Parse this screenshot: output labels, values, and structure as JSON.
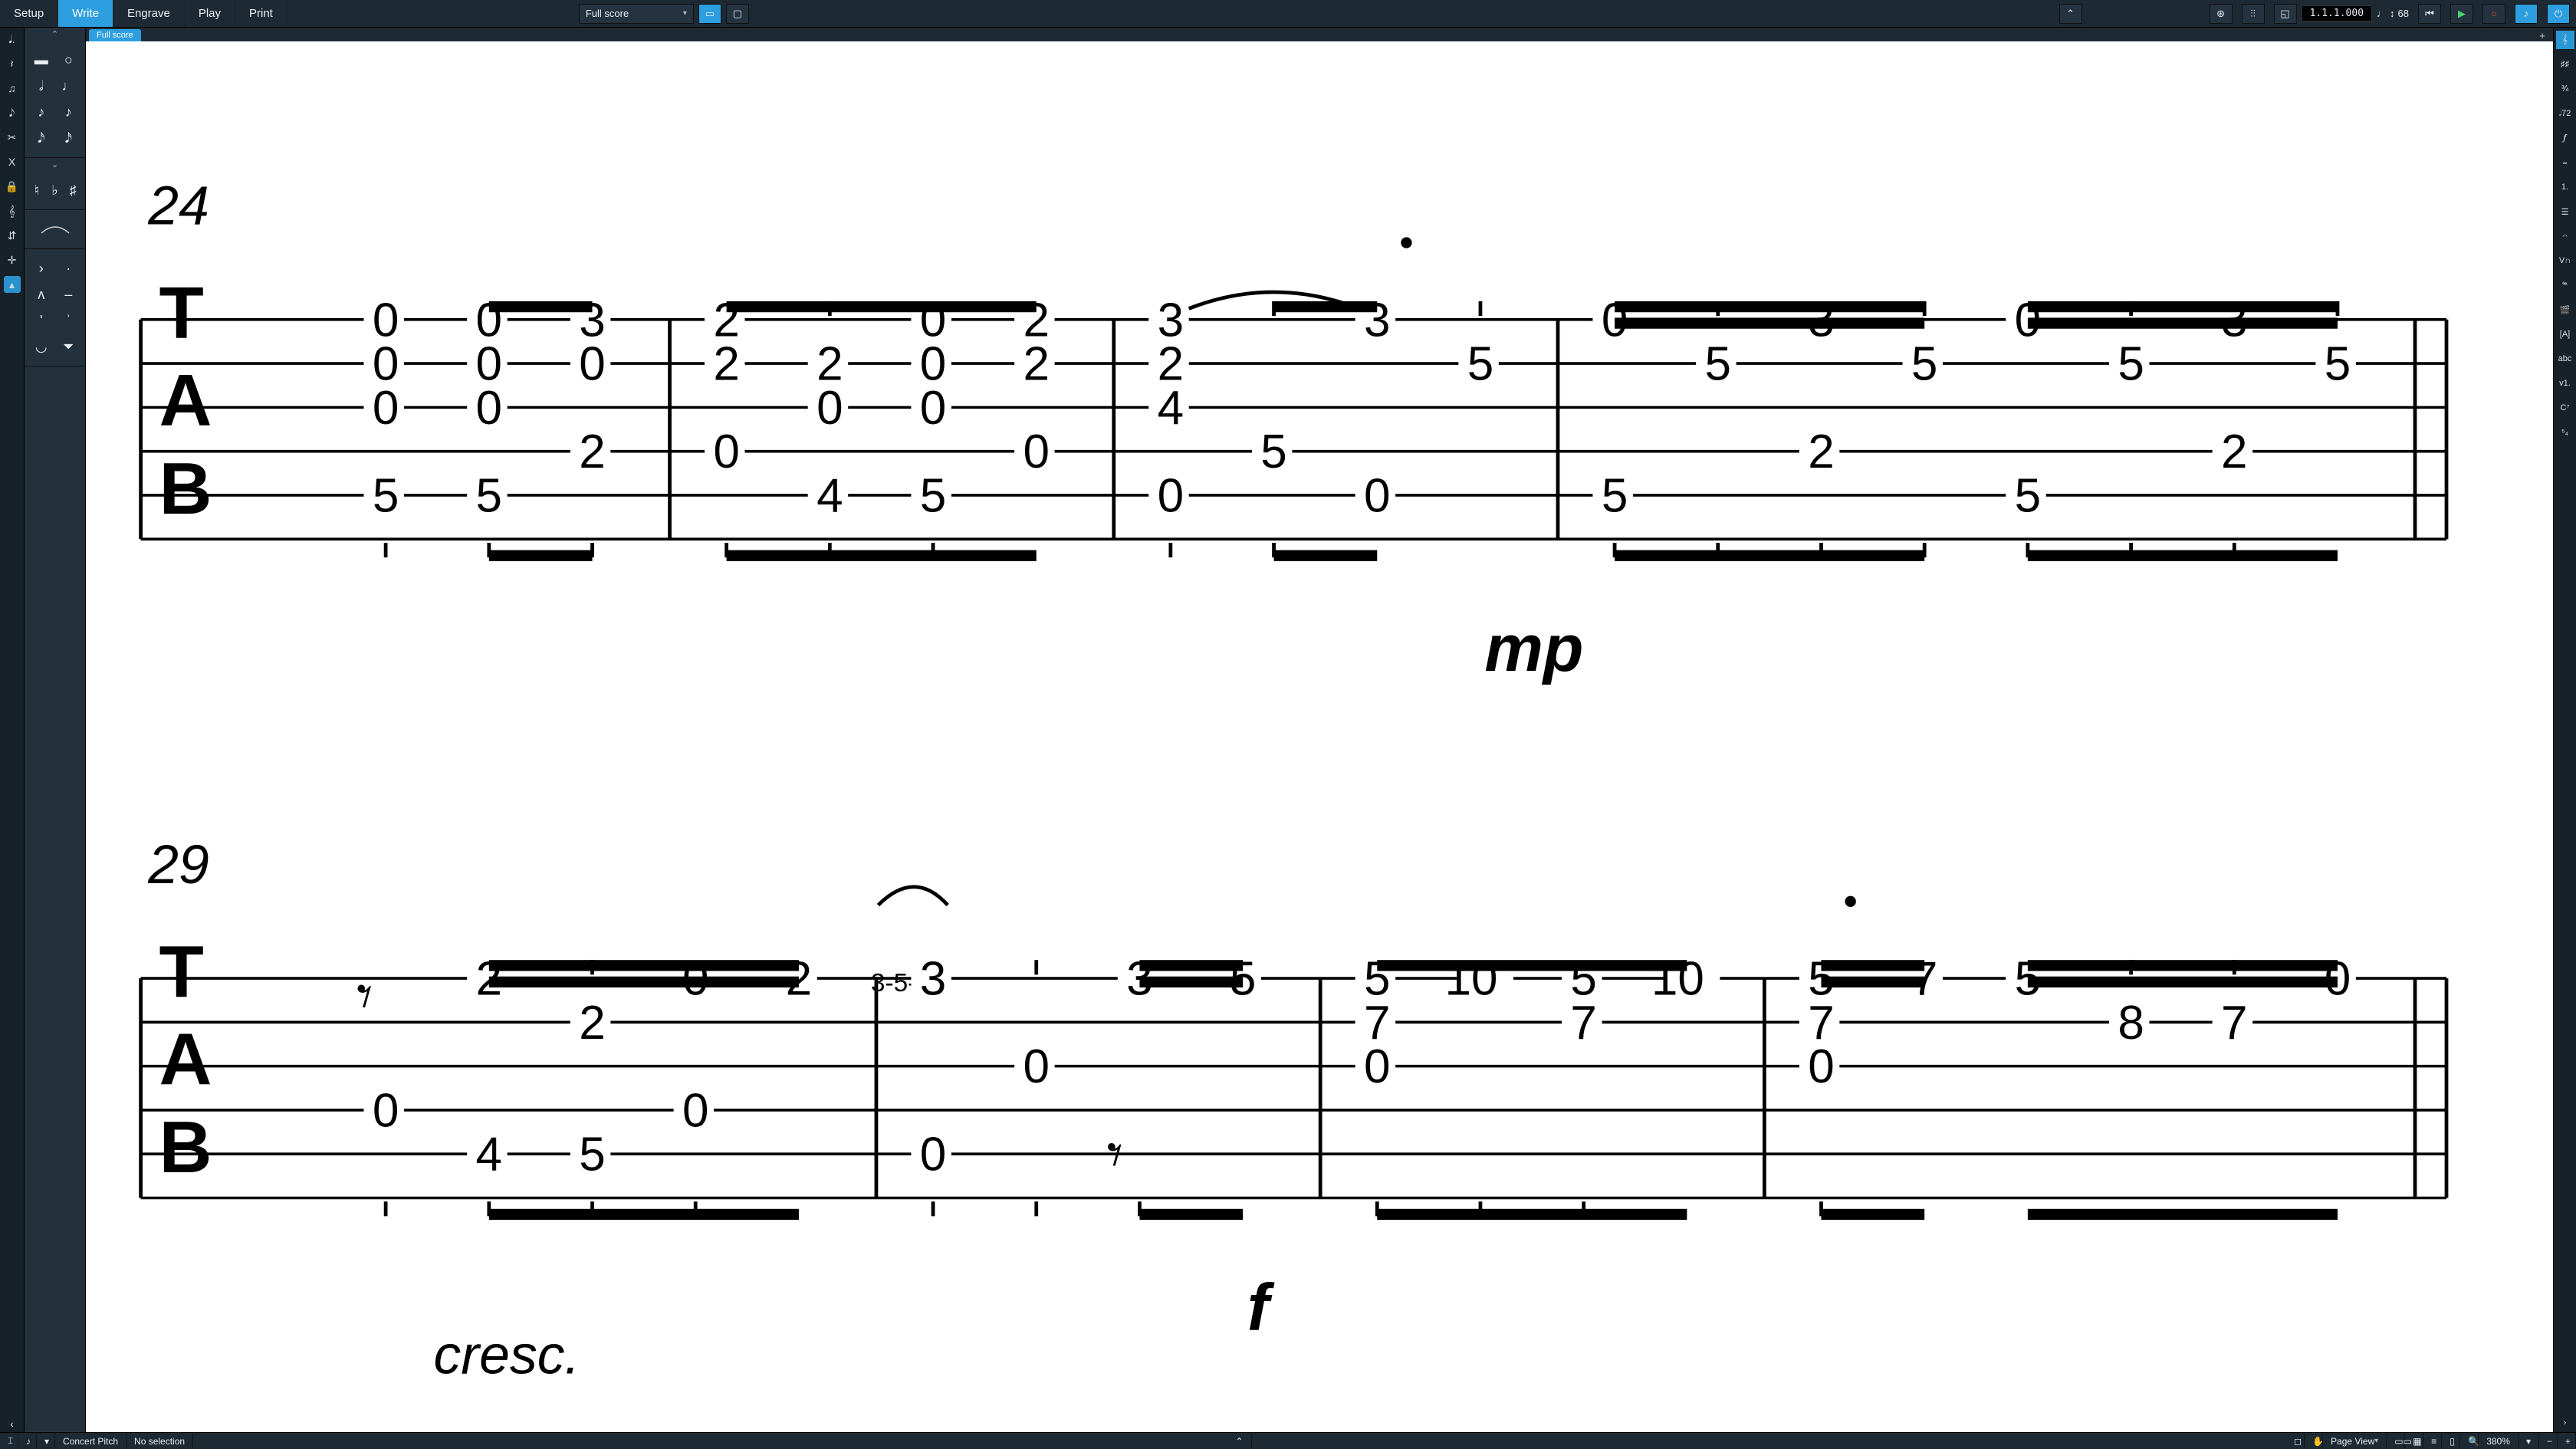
{
  "modes": [
    "Setup",
    "Write",
    "Engrave",
    "Play",
    "Print"
  ],
  "active_mode": "Write",
  "layout_selector": "Full score",
  "doc_tab": "Full score",
  "transport": {
    "position": "1.1.1.000",
    "tempo": "68"
  },
  "status": {
    "pitch": "Concert Pitch",
    "selection": "No selection",
    "view": "Page View",
    "zoom": "380%"
  },
  "right_panel": [
    "𝄞",
    "♯♯",
    "¾",
    "𝅗𝅥72",
    "𝆑",
    "𝆗",
    "1.",
    "☰",
    "𝄐",
    "V∩",
    "𝆮",
    "🎬",
    "[A]",
    "abc",
    "v1.",
    "C⁷",
    "⁵₄"
  ],
  "left_toolbox": [
    "𝅘𝅥.",
    "𝄽",
    "♫",
    "𝅘𝅥𝅮",
    "✂",
    "X",
    "🔒",
    "𝄞",
    "⇵",
    "✛"
  ],
  "score": {
    "systems": [
      {
        "bar_start": "24",
        "dyn": "mp",
        "measures": [
          {
            "cols": [
              {
                "stem": "u",
                "frets": [
                  {
                    "s": 1,
                    "f": "0"
                  },
                  {
                    "s": 2,
                    "f": "0"
                  },
                  {
                    "s": 3,
                    "f": "0"
                  },
                  {
                    "s": 5,
                    "f": "5"
                  }
                ],
                "lb": true
              },
              {
                "stem": "u",
                "beam": "s",
                "frets": [
                  {
                    "s": 1,
                    "f": "0"
                  },
                  {
                    "s": 2,
                    "f": "0"
                  },
                  {
                    "s": 3,
                    "f": "0"
                  },
                  {
                    "s": 5,
                    "f": "5"
                  }
                ],
                "lb": true
              },
              {
                "stem": "u",
                "beam": "e",
                "frets": [
                  {
                    "s": 1,
                    "f": "3"
                  },
                  {
                    "s": 2,
                    "f": "0"
                  },
                  {
                    "s": 4,
                    "f": "2"
                  }
                ],
                "lb": true
              }
            ]
          },
          {
            "cols": [
              {
                "stem": "u",
                "beam": "s",
                "frets": [
                  {
                    "s": 1,
                    "f": "2"
                  },
                  {
                    "s": 2,
                    "f": "2"
                  },
                  {
                    "s": 4,
                    "f": "0"
                  }
                ],
                "lb": true
              },
              {
                "stem": "u",
                "beam": "m",
                "frets": [
                  {
                    "s": 2,
                    "f": "2"
                  },
                  {
                    "s": 3,
                    "f": "0"
                  },
                  {
                    "s": 5,
                    "f": "4"
                  }
                ],
                "lb": true
              },
              {
                "stem": "u",
                "beam": "m",
                "frets": [
                  {
                    "s": 1,
                    "f": "0"
                  },
                  {
                    "s": 2,
                    "f": "0"
                  },
                  {
                    "s": 3,
                    "f": "0"
                  },
                  {
                    "s": 5,
                    "f": "5"
                  }
                ],
                "lb": true
              },
              {
                "stem": "u",
                "beam": "e",
                "frets": [
                  {
                    "s": 1,
                    "f": "2"
                  },
                  {
                    "s": 2,
                    "f": "2"
                  },
                  {
                    "s": 4,
                    "f": "0"
                  }
                ]
              }
            ]
          },
          {
            "cols": [
              {
                "stem": "u",
                "frets": [
                  {
                    "s": 1,
                    "f": "3",
                    "tie": true
                  },
                  {
                    "s": 2,
                    "f": "2"
                  },
                  {
                    "s": 3,
                    "f": "4"
                  },
                  {
                    "s": 5,
                    "f": "0"
                  }
                ],
                "lb": true
              },
              {
                "stem": "u",
                "beam": "s",
                "frets": [
                  {
                    "s": 4,
                    "f": "5"
                  }
                ],
                "lb": true
              },
              {
                "stem": "u",
                "beam": "e",
                "dot": true,
                "frets": [
                  {
                    "s": 1,
                    "f": "3"
                  },
                  {
                    "s": 5,
                    "f": "0"
                  }
                ]
              },
              {
                "stem": "u",
                "beam": "e16",
                "frets": [
                  {
                    "s": 2,
                    "f": "5"
                  }
                ]
              }
            ]
          },
          {
            "cols": [
              {
                "stem": "u",
                "beam": "s16",
                "frets": [
                  {
                    "s": 1,
                    "f": "0"
                  },
                  {
                    "s": 5,
                    "f": "5"
                  }
                ],
                "lb": true
              },
              {
                "stem": "u",
                "beam": "m16",
                "frets": [
                  {
                    "s": 2,
                    "f": "5"
                  }
                ],
                "lb": true
              },
              {
                "stem": "u",
                "beam": "m16",
                "frets": [
                  {
                    "s": 1,
                    "f": "3"
                  },
                  {
                    "s": 4,
                    "f": "2"
                  }
                ],
                "lb": true
              },
              {
                "stem": "u",
                "beam": "e16",
                "frets": [
                  {
                    "s": 2,
                    "f": "5"
                  }
                ],
                "lb": true
              },
              {
                "stem": "u",
                "beam": "s16",
                "frets": [
                  {
                    "s": 1,
                    "f": "0"
                  },
                  {
                    "s": 5,
                    "f": "5"
                  }
                ],
                "lb": true
              },
              {
                "stem": "u",
                "beam": "m16",
                "frets": [
                  {
                    "s": 2,
                    "f": "5"
                  }
                ],
                "lb": true
              },
              {
                "stem": "u",
                "beam": "m16",
                "frets": [
                  {
                    "s": 1,
                    "f": "3"
                  },
                  {
                    "s": 4,
                    "f": "2"
                  }
                ],
                "lb": true
              },
              {
                "stem": "u",
                "beam": "e16",
                "frets": [
                  {
                    "s": 2,
                    "f": "5"
                  }
                ]
              }
            ]
          }
        ]
      },
      {
        "bar_start": "29",
        "dyn": "f",
        "dyn_text": "cresc.",
        "measures": [
          {
            "cols": [
              {
                "stem": "n",
                "frets": [
                  {
                    "s": 4,
                    "f": "0"
                  }
                ],
                "lb": true,
                "rest8": true
              },
              {
                "stem": "u",
                "beam": "s",
                "frets": [
                  {
                    "s": 1,
                    "f": "2"
                  },
                  {
                    "s": 5,
                    "f": "4"
                  }
                ],
                "lb": true
              },
              {
                "stem": "u",
                "beam": "m",
                "frets": [
                  {
                    "s": 2,
                    "f": "2"
                  },
                  {
                    "s": 5,
                    "f": "5"
                  }
                ],
                "lb": true
              },
              {
                "stem": "u",
                "beam": "m",
                "frets": [
                  {
                    "s": 1,
                    "f": "0"
                  },
                  {
                    "s": 4,
                    "f": "0"
                  }
                ],
                "lb": true
              },
              {
                "stem": "u",
                "beam": "e16",
                "frets": [
                  {
                    "s": 1,
                    "f": "2"
                  }
                ]
              }
            ]
          },
          {
            "cols": [
              {
                "stem": "u",
                "frets": [
                  {
                    "s": 1,
                    "f": "3",
                    "grace": "3-5-"
                  },
                  {
                    "s": 5,
                    "f": "0"
                  }
                ],
                "lb": true,
                "slur": true
              },
              {
                "stem": "u",
                "frets": [
                  {
                    "s": 3,
                    "f": "0"
                  }
                ],
                "lb": true
              },
              {
                "stem": "u",
                "beam": "s",
                "frets": [
                  {
                    "s": 1,
                    "f": "3"
                  }
                ],
                "lb": true,
                "rest8b": true
              },
              {
                "stem": "u",
                "beam": "e16",
                "frets": [
                  {
                    "s": 1,
                    "f": "5"
                  }
                ]
              }
            ]
          },
          {
            "cols": [
              {
                "stem": "u",
                "beam": "s",
                "frets": [
                  {
                    "s": 1,
                    "f": "5"
                  },
                  {
                    "s": 2,
                    "f": "7"
                  },
                  {
                    "s": 3,
                    "f": "0"
                  }
                ],
                "lb": true
              },
              {
                "stem": "u",
                "beam": "m",
                "frets": [
                  {
                    "s": 1,
                    "f": "10"
                  }
                ],
                "lb": true
              },
              {
                "stem": "u",
                "beam": "m",
                "frets": [
                  {
                    "s": 1,
                    "f": "5"
                  },
                  {
                    "s": 2,
                    "f": "7"
                  }
                ],
                "lb": true
              },
              {
                "stem": "u",
                "beam": "e",
                "frets": [
                  {
                    "s": 1,
                    "f": "10"
                  }
                ]
              }
            ]
          },
          {
            "cols": [
              {
                "stem": "u",
                "beam": "s",
                "dot": true,
                "frets": [
                  {
                    "s": 1,
                    "f": "5"
                  },
                  {
                    "s": 2,
                    "f": "7"
                  },
                  {
                    "s": 3,
                    "f": "0"
                  }
                ],
                "lb": true
              },
              {
                "stem": "u",
                "beam": "e16",
                "frets": [
                  {
                    "s": 1,
                    "f": "7"
                  }
                ]
              },
              {
                "stem": "u",
                "beam": "s16",
                "frets": [
                  {
                    "s": 1,
                    "f": "5"
                  }
                ]
              },
              {
                "stem": "u",
                "beam": "m16",
                "frets": [
                  {
                    "s": 2,
                    "f": "8"
                  }
                ]
              },
              {
                "stem": "u",
                "beam": "m16",
                "frets": [
                  {
                    "s": 2,
                    "f": "7"
                  }
                ]
              },
              {
                "stem": "u",
                "beam": "e16",
                "frets": [
                  {
                    "s": 1,
                    "f": "0"
                  }
                ]
              }
            ]
          }
        ]
      }
    ]
  }
}
